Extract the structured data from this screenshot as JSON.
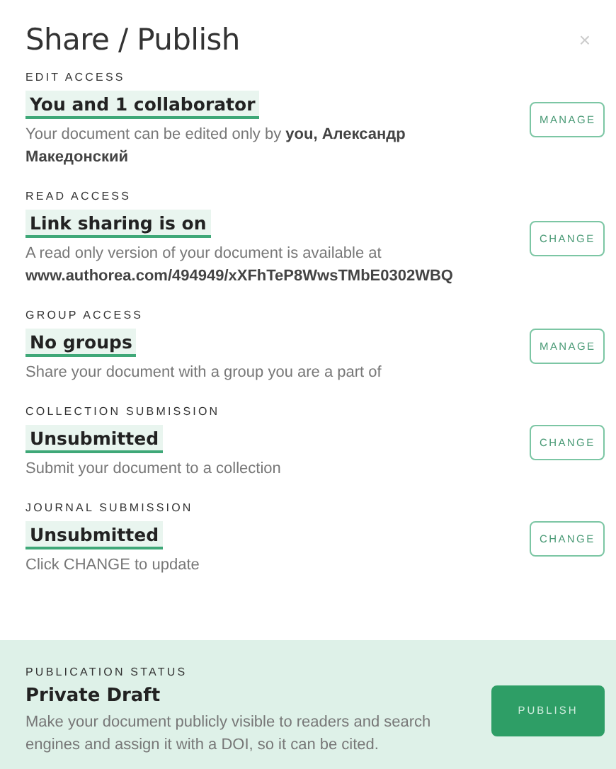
{
  "title": "Share / Publish",
  "close": "×",
  "sections": [
    {
      "label": "EDIT ACCESS",
      "value": "You and 1 collaborator",
      "description": "Your document can be edited only by **you, Александр Македонский**",
      "button": "MANAGE"
    },
    {
      "label": "READ ACCESS",
      "value": "Link sharing is on",
      "description": "A read only version of your document is available at **www.authorea.com/494949/xXFhTeP8WwsTMbE0302WBQ**",
      "button": "CHANGE"
    },
    {
      "label": "GROUP ACCESS",
      "value": "No groups",
      "description": "Share your document with a group you are a part of",
      "button": "MANAGE"
    },
    {
      "label": "COLLECTION SUBMISSION",
      "value": "Unsubmitted",
      "description": "Submit your document to a collection",
      "button": "CHANGE"
    },
    {
      "label": "JOURNAL SUBMISSION",
      "value": "Unsubmitted",
      "description": "Click CHANGE to update",
      "button": "CHANGE"
    }
  ],
  "publication": {
    "label": "PUBLICATION STATUS",
    "value": "Private Draft",
    "description": "Make your document publicly visible to readers and search engines and assign it with a DOI, so it can be cited.",
    "button": "PUBLISH"
  }
}
